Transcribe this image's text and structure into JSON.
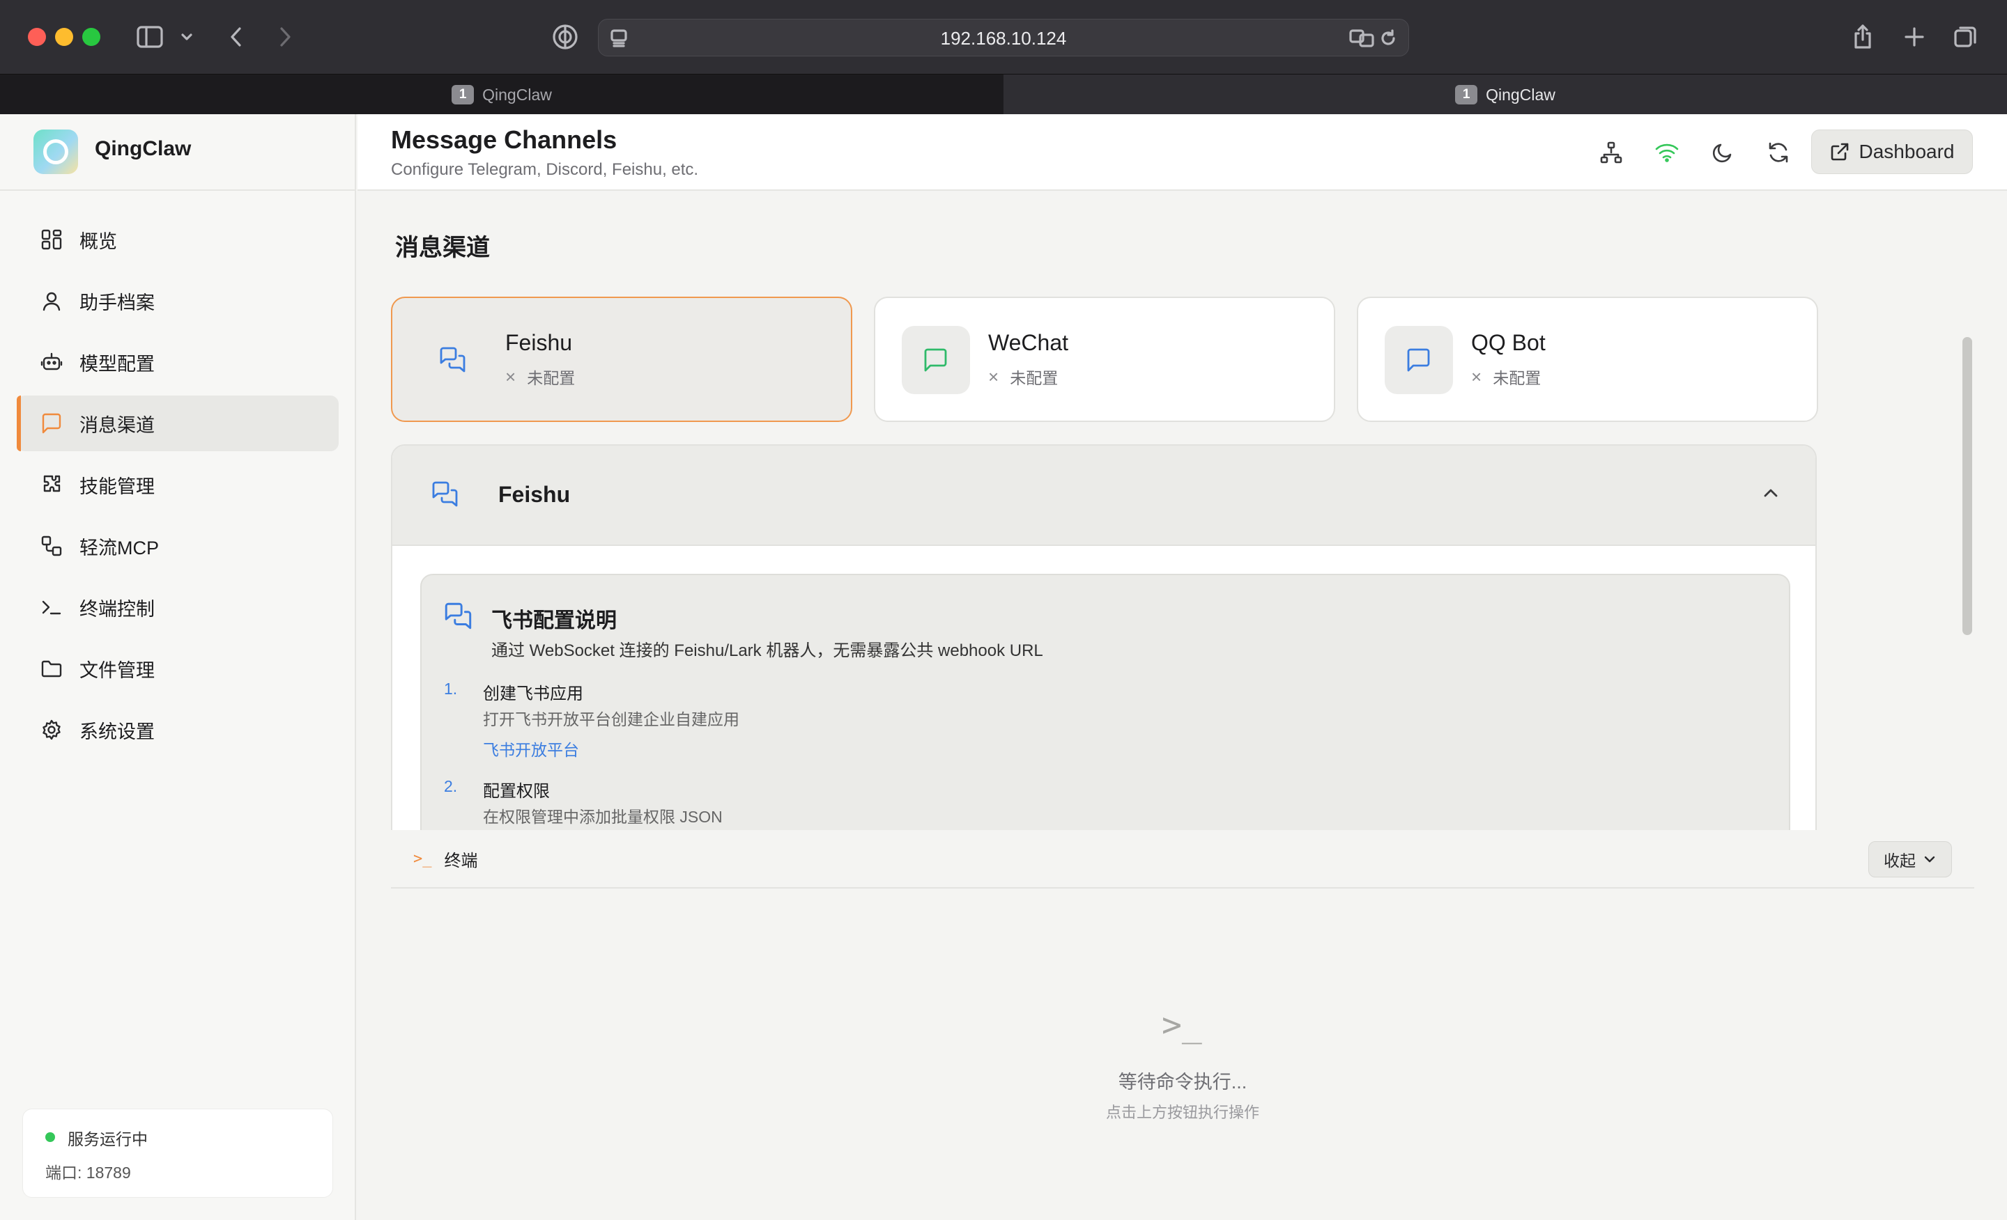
{
  "browser": {
    "url": "192.168.10.124",
    "tabs": [
      {
        "badge": "1",
        "title": "QingClaw",
        "active": false
      },
      {
        "badge": "1",
        "title": "QingClaw",
        "active": true
      }
    ]
  },
  "sidebar": {
    "brand": "QingClaw",
    "items": [
      {
        "label": "概览",
        "icon": "grid-icon",
        "active": false
      },
      {
        "label": "助手档案",
        "icon": "user-icon",
        "active": false
      },
      {
        "label": "模型配置",
        "icon": "robot-icon",
        "active": false
      },
      {
        "label": "消息渠道",
        "icon": "message-icon",
        "active": true
      },
      {
        "label": "技能管理",
        "icon": "puzzle-icon",
        "active": false
      },
      {
        "label": "轻流MCP",
        "icon": "connect-icon",
        "active": false
      },
      {
        "label": "终端控制",
        "icon": "terminal-icon",
        "active": false
      },
      {
        "label": "文件管理",
        "icon": "folder-icon",
        "active": false
      },
      {
        "label": "系统设置",
        "icon": "gear-icon",
        "active": false
      }
    ],
    "status": {
      "text": "服务运行中",
      "port": "端口: 18789"
    }
  },
  "header": {
    "title": "Message Channels",
    "subtitle": "Configure Telegram, Discord, Feishu, etc.",
    "dashboard_label": "Dashboard"
  },
  "main": {
    "section_title": "消息渠道",
    "channels": [
      {
        "name": "Feishu",
        "status": "未配置",
        "icon_color": "#3b7de0",
        "selected": true
      },
      {
        "name": "WeChat",
        "status": "未配置",
        "icon_color": "#2fba6a",
        "selected": false
      },
      {
        "name": "QQ Bot",
        "status": "未配置",
        "icon_color": "#3b7de0",
        "selected": false
      }
    ],
    "panel": {
      "title": "Feishu",
      "guide_title": "飞书配置说明",
      "guide_desc": "通过 WebSocket 连接的 Feishu/Lark 机器人，无需暴露公共 webhook URL",
      "steps": [
        {
          "num": "1.",
          "title": "创建飞书应用",
          "desc": "打开飞书开放平台创建企业自建应用",
          "link": "飞书开放平台"
        },
        {
          "num": "2.",
          "title": "配置权限",
          "desc": "在权限管理中添加批量权限 JSON",
          "link": ""
        }
      ]
    }
  },
  "terminal": {
    "label": "终端",
    "collapse_label": "收起",
    "empty_title": "等待命令执行...",
    "empty_sub": "点击上方按钮执行操作"
  },
  "colors": {
    "accent": "#f08a3c",
    "link": "#3b7de0",
    "status_ok": "#34c759"
  }
}
